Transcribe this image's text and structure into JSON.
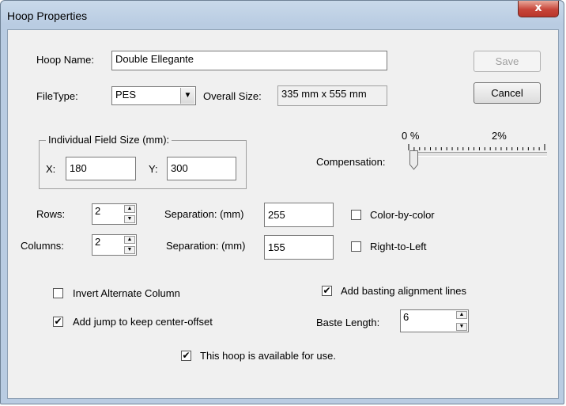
{
  "window": {
    "title": "Hoop Properties",
    "close_glyph": "x"
  },
  "hoop_name": {
    "label": "Hoop Name:",
    "value": "Double Ellegante"
  },
  "filetype": {
    "label": "FileType:",
    "value": "PES",
    "arrow": "▼"
  },
  "overall_size": {
    "label": "Overall Size:",
    "value": "335 mm x 555 mm"
  },
  "buttons": {
    "save": "Save",
    "cancel": "Cancel"
  },
  "field_size": {
    "group_label": "Individual Field Size (mm):",
    "x_label": "X:",
    "x_value": "180",
    "y_label": "Y:",
    "y_value": "300"
  },
  "compensation": {
    "label": "Compensation:",
    "min_label": "0 %",
    "max_label": "2%",
    "value_fraction": 0
  },
  "rows": {
    "label": "Rows:",
    "value": "2",
    "sep_label": "Separation: (mm)",
    "sep_value": "255"
  },
  "columns": {
    "label": "Columns:",
    "value": "2",
    "sep_label": "Separation: (mm)",
    "sep_value": "155"
  },
  "checkboxes": {
    "color_by_color": {
      "label": "Color-by-color",
      "checked": false
    },
    "right_to_left": {
      "label": "Right-to-Left",
      "checked": false
    },
    "invert_alternate": {
      "label": "Invert Alternate Column",
      "checked": false
    },
    "add_jump": {
      "label": "Add jump to keep center-offset",
      "checked": true
    },
    "add_basting": {
      "label": "Add basting alignment lines",
      "checked": true
    },
    "available": {
      "label": "This hoop is available for use.",
      "checked": true
    }
  },
  "baste_length": {
    "label": "Baste Length:",
    "value": "6"
  },
  "check_glyph": "✔",
  "spin_up_glyph": "▲",
  "spin_down_glyph": "▼"
}
